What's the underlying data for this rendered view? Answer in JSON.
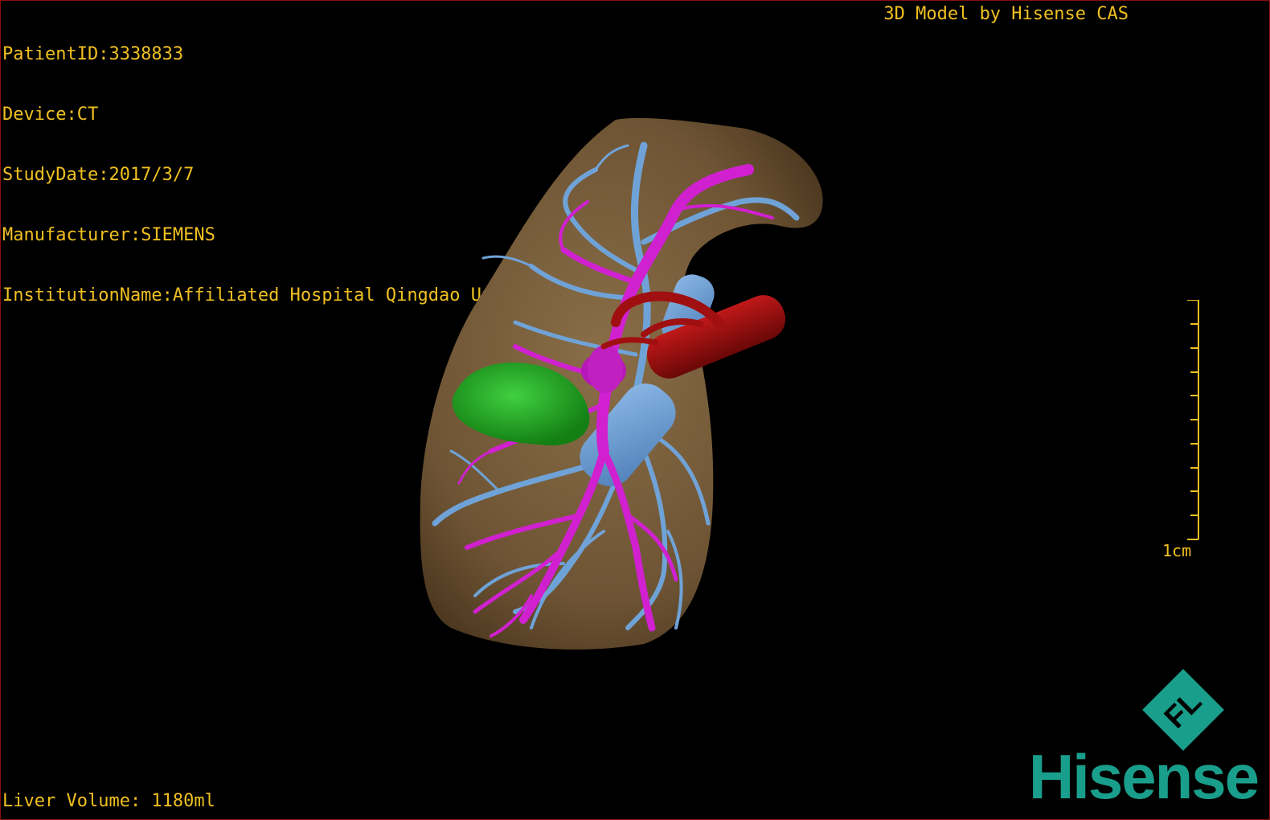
{
  "info": {
    "patient_id": "PatientID:3338833",
    "device": "Device:CT",
    "study_date": "StudyDate:2017/3/7",
    "manufacturer": "Manufacturer:SIEMENS",
    "institution": "InstitutionName:Affiliated Hospital Qingdao University-C"
  },
  "credit": "3D Model by Hisense CAS",
  "volume": "Liver Volume: 1180ml",
  "scale_label": "1cm",
  "logo": {
    "mark": "FL",
    "wordmark": "Hisense",
    "color": "#1a9e8c"
  },
  "colors": {
    "text": "#f0c020",
    "liver": "#7a6040",
    "portal_vein": "#d020d0",
    "hepatic_vein": "#6fa3d8",
    "artery": "#a01010",
    "tumor": "#20a020"
  }
}
